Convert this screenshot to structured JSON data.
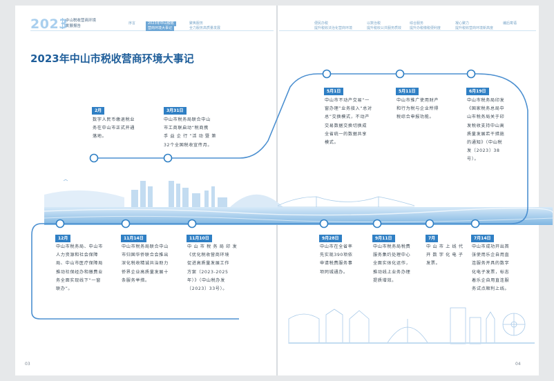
{
  "header": {
    "year": "2023",
    "report_line1": "中山税收营商环境",
    "report_line2": "发展报告",
    "nav": [
      {
        "a": "序言",
        "b": ""
      },
      {
        "a": "2023年中山税收",
        "b": "营商环境大事记"
      },
      {
        "a": "聚焦服务",
        "b": "全力服务高质量发展"
      },
      {
        "a": "便民办税",
        "b": "提升税收法治化营商环境"
      },
      {
        "a": "以数治税",
        "b": "提升税收公共服务质效"
      },
      {
        "a": "综合服务",
        "b": "提升办税缴税便利度"
      },
      {
        "a": "凝心聚力",
        "b": "提升税收营商环境新高度"
      },
      {
        "a": "编后寄语",
        "b": ""
      }
    ]
  },
  "title": "2023年中山市税收营商环境大事记",
  "events": [
    {
      "date": "2月",
      "text": [
        "数字人民币缴退税业",
        "务在中山市正式开通",
        "落地。"
      ]
    },
    {
      "date": "3月31日",
      "text": [
        "中山市税务局联合中山",
        "市工商联启动“税商携",
        "手 益 企 行 ”活 动 暨 第",
        "32个全国税收宣传月。"
      ]
    },
    {
      "date": "5月1日",
      "text": [
        "中山市不动产交易“一",
        "窗办理”业务接入“总对",
        "总”交换模式，不动产",
        "交易数据交换切换成",
        "全省统一的数据共享",
        "模式。"
      ]
    },
    {
      "date": "5月11日",
      "text": [
        "中山市推广使用财产",
        "和行为税与企业所得",
        "税综合申报功能。"
      ]
    },
    {
      "date": "6月19日",
      "text": [
        "中山市税务局印发",
        "《国家税务总局中",
        "山市税务局关于印",
        "发税收支持中山高",
        "质量发展若干措施",
        "的通知》（中山税",
        "发〔2023〕38",
        "号）。"
      ]
    },
    {
      "date": "12月",
      "text": [
        "中山市税务局、中山市",
        "人力资源和社会保障",
        "局、中山市医疗保障局",
        "推动社保经办和缴费业",
        "务全面实现线下“一窗",
        "联办”。"
      ]
    },
    {
      "date": "11月14日",
      "text": [
        "中山市税务局联合中山",
        "市归国华侨联合会推出",
        "深化税收精诚共治助力",
        "侨界企业高质量发展十",
        "条服务举措。"
      ]
    },
    {
      "date": "11月10日",
      "text": [
        "中 山 市 税 务 局 印 发",
        "《优化税收营商环境",
        "促进高质量发展工作",
        "方案（2023-2025",
        "年）》（中山税办发",
        "〔2023〕33号）。"
      ]
    },
    {
      "date": "9月28日",
      "text": [
        "中山市在全省率",
        "先实现390项依",
        "申请税费服务事",
        "项同城通办。"
      ]
    },
    {
      "date": "9月11日",
      "text": [
        "中山市税务局税费",
        "服务集约处理中心",
        "全面实体化运作，",
        "推动线上业务办理",
        "提质增效。"
      ]
    },
    {
      "date": "7月",
      "text": [
        "中 山 市 上 线 代",
        "开 数 字 化 电 子",
        "发票。"
      ]
    },
    {
      "date": "7月14日",
      "text": [
        "中山市成功开出首",
        "张使用乐企自用直",
        "连服务开具的数字",
        "化电子发票，标志",
        "着乐企自用直连服",
        "务试点顺利上线。"
      ]
    }
  ],
  "page_numbers": {
    "left": "03",
    "right": "04"
  },
  "colors": {
    "accent": "#2f7fc4",
    "title": "#1f5e9a",
    "line": "#4b8fd0",
    "year": "#a9cfee"
  }
}
